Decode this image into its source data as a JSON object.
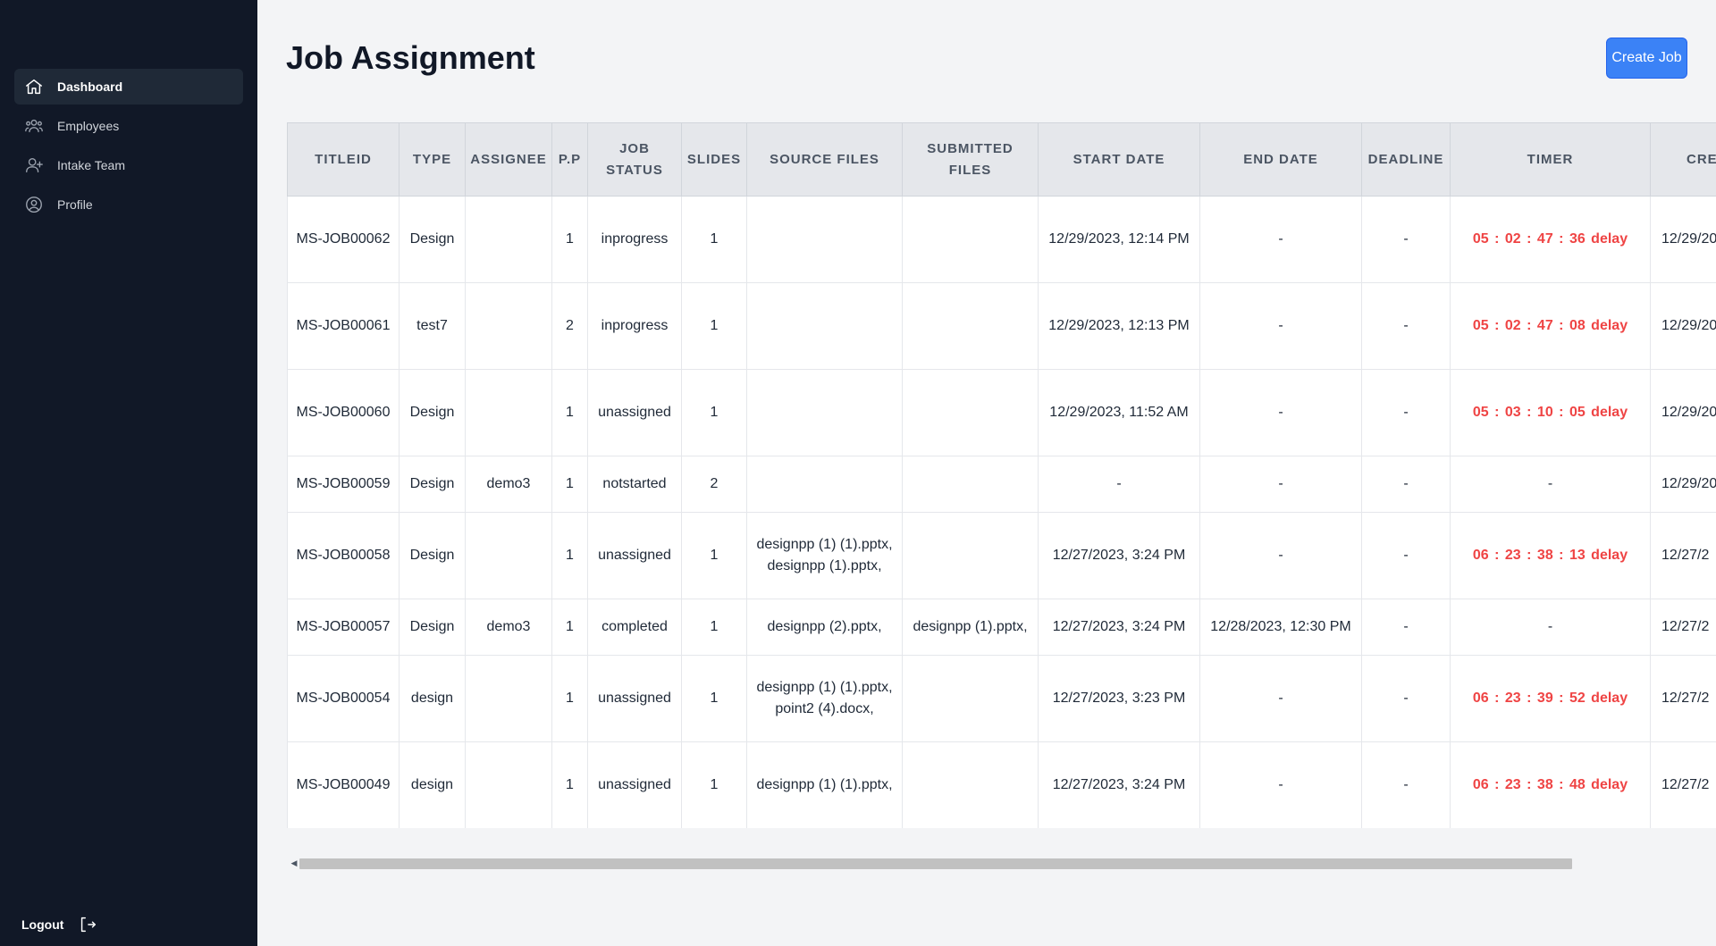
{
  "sidebar": {
    "items": [
      {
        "label": "Dashboard",
        "icon": "home-icon",
        "active": true
      },
      {
        "label": "Employees",
        "icon": "users-icon",
        "active": false
      },
      {
        "label": "Intake Team",
        "icon": "user-plus-icon",
        "active": false
      },
      {
        "label": "Profile",
        "icon": "user-circle-icon",
        "active": false
      }
    ],
    "logout_label": "Logout"
  },
  "header": {
    "title": "Job Assignment",
    "create_button": "Create Job"
  },
  "table": {
    "columns": [
      "TitleID",
      "Type",
      "Assignee",
      "P.P",
      "Job Status",
      "Slides",
      "Source Files",
      "Submitted Files",
      "Start Date",
      "End Date",
      "Deadline",
      "Timer",
      "Crea"
    ],
    "rows": [
      {
        "titleid": "MS-JOB00062",
        "type": "Design",
        "assignee": "",
        "pp": "1",
        "status": "inprogress",
        "slides": "1",
        "source": [],
        "submitted": [],
        "start": "12/29/2023, 12:14 PM",
        "end": "-",
        "deadline": "-",
        "timer": "05 : 02 : 47 : 36 delay",
        "created": "12/29/20"
      },
      {
        "titleid": "MS-JOB00061",
        "type": "test7",
        "assignee": "",
        "pp": "2",
        "status": "inprogress",
        "slides": "1",
        "source": [],
        "submitted": [],
        "start": "12/29/2023, 12:13 PM",
        "end": "-",
        "deadline": "-",
        "timer": "05 : 02 : 47 : 08 delay",
        "created": "12/29/20"
      },
      {
        "titleid": "MS-JOB00060",
        "type": "Design",
        "assignee": "",
        "pp": "1",
        "status": "unassigned",
        "slides": "1",
        "source": [],
        "submitted": [],
        "start": "12/29/2023, 11:52 AM",
        "end": "-",
        "deadline": "-",
        "timer": "05 : 03 : 10 : 05 delay",
        "created": "12/29/20"
      },
      {
        "titleid": "MS-JOB00059",
        "type": "Design",
        "assignee": "demo3",
        "pp": "1",
        "status": "notstarted",
        "slides": "2",
        "source": [],
        "submitted": [],
        "start": "-",
        "end": "-",
        "deadline": "-",
        "timer": "-",
        "created": "12/29/20"
      },
      {
        "titleid": "MS-JOB00058",
        "type": "Design",
        "assignee": "",
        "pp": "1",
        "status": "unassigned",
        "slides": "1",
        "source": [
          "designpp (1) (1).pptx,",
          "designpp (1).pptx,"
        ],
        "submitted": [],
        "start": "12/27/2023, 3:24 PM",
        "end": "-",
        "deadline": "-",
        "timer": "06 : 23 : 38 : 13 delay",
        "created": "12/27/2"
      },
      {
        "titleid": "MS-JOB00057",
        "type": "Design",
        "assignee": "demo3",
        "pp": "1",
        "status": "completed",
        "slides": "1",
        "source": [
          "designpp (2).pptx,"
        ],
        "submitted": [
          "designpp (1).pptx,"
        ],
        "start": "12/27/2023, 3:24 PM",
        "end": "12/28/2023, 12:30 PM",
        "deadline": "-",
        "timer": "-",
        "created": "12/27/2"
      },
      {
        "titleid": "MS-JOB00054",
        "type": "design",
        "assignee": "",
        "pp": "1",
        "status": "unassigned",
        "slides": "1",
        "source": [
          "designpp (1) (1).pptx,",
          "point2 (4).docx,"
        ],
        "submitted": [],
        "start": "12/27/2023, 3:23 PM",
        "end": "-",
        "deadline": "-",
        "timer": "06 : 23 : 39 : 52 delay",
        "created": "12/27/2"
      },
      {
        "titleid": "MS-JOB00049",
        "type": "design",
        "assignee": "",
        "pp": "1",
        "status": "unassigned",
        "slides": "1",
        "source": [
          "designpp (1) (1).pptx,"
        ],
        "submitted": [],
        "start": "12/27/2023, 3:24 PM",
        "end": "-",
        "deadline": "-",
        "timer": "06 : 23 : 38 : 48 delay",
        "created": "12/27/2"
      }
    ]
  },
  "colors": {
    "sidebar_bg": "#111827",
    "accent": "#3b82f6",
    "delay": "#ef4444"
  }
}
